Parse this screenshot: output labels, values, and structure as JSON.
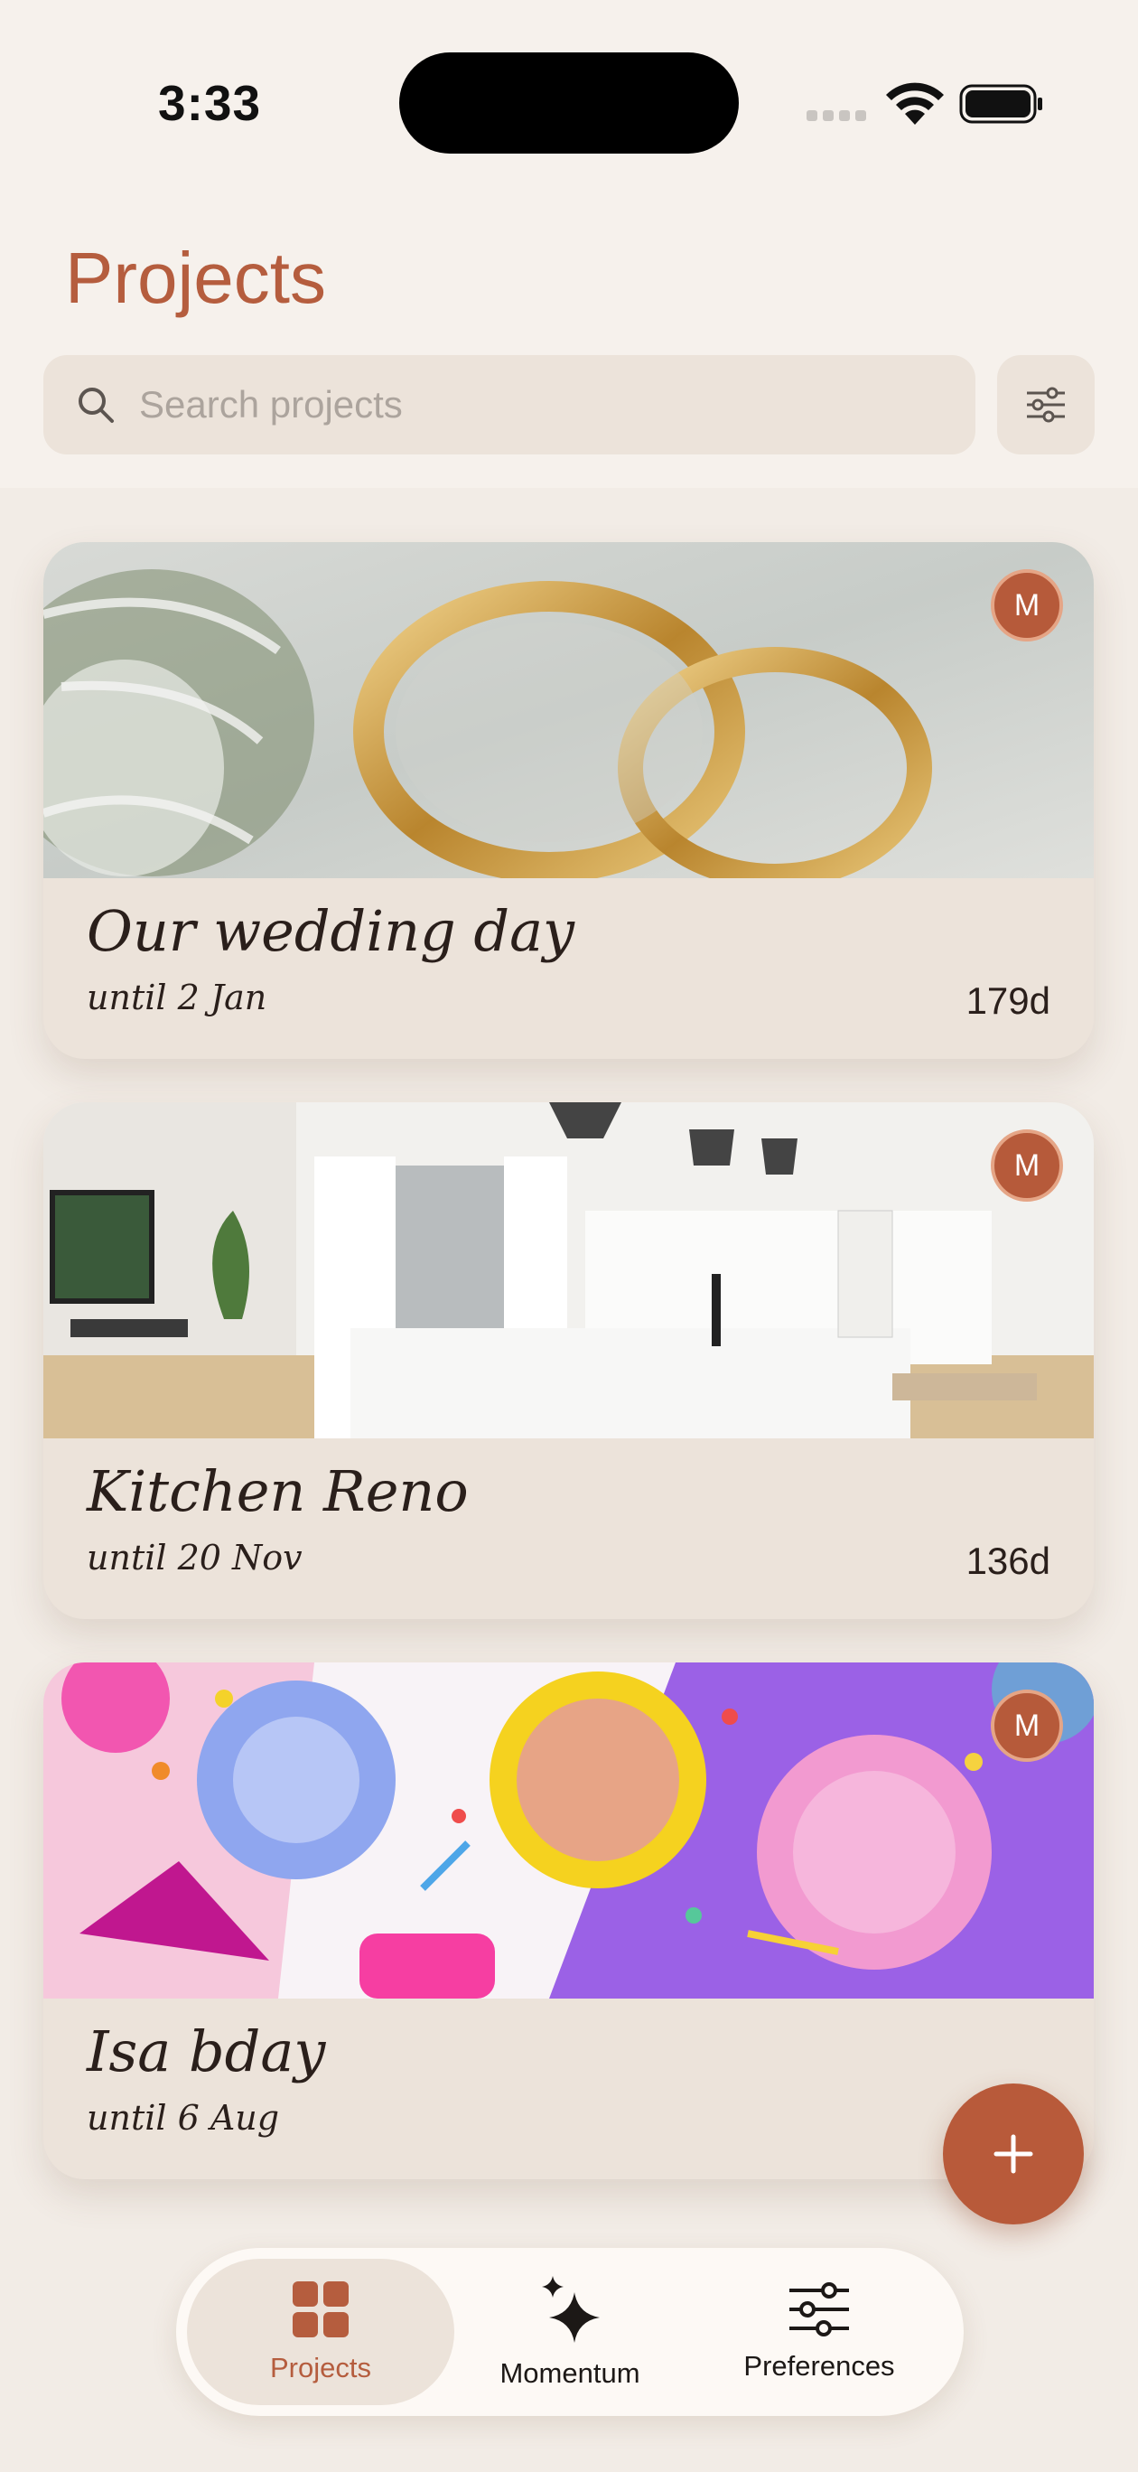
{
  "status_bar": {
    "time": "3:33"
  },
  "header": {
    "title": "Projects",
    "search_placeholder": "Search projects"
  },
  "projects": [
    {
      "title": "Our wedding day",
      "deadline": "until 2 Jan",
      "days_left": "179d",
      "owner_initial": "M"
    },
    {
      "title": "Kitchen Reno",
      "deadline": "until 20 Nov",
      "days_left": "136d",
      "owner_initial": "M"
    },
    {
      "title": "Isa bday",
      "deadline": "until 6 Aug",
      "days_left": "",
      "owner_initial": "M"
    }
  ],
  "nav": {
    "items": [
      {
        "label": "Projects",
        "icon": "grid-icon",
        "active": true
      },
      {
        "label": "Momentum",
        "icon": "sparkle-icon",
        "active": false
      },
      {
        "label": "Preferences",
        "icon": "sliders-icon",
        "active": false
      }
    ]
  },
  "colors": {
    "accent": "#b55d3e",
    "background": "#f6f1ec",
    "card": "#ece3da"
  }
}
